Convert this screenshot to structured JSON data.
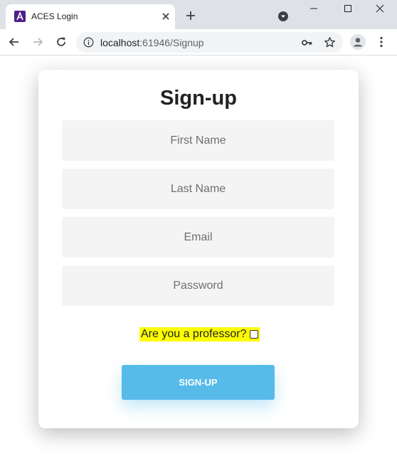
{
  "browser": {
    "tab_title": "ACES Login",
    "favicon_letter": "A",
    "url_host": "localhost",
    "url_rest": ":61946/Signup"
  },
  "form": {
    "title": "Sign-up",
    "first_name_placeholder": "First Name",
    "last_name_placeholder": "Last Name",
    "email_placeholder": "Email",
    "password_placeholder": "Password",
    "professor_label": "Are you a professor?",
    "professor_checked": false,
    "submit_label": "SIGN-UP"
  },
  "colors": {
    "submit_button": "#56bbe9",
    "highlight": "#fefe00",
    "favicon": "#4b1f8a"
  }
}
